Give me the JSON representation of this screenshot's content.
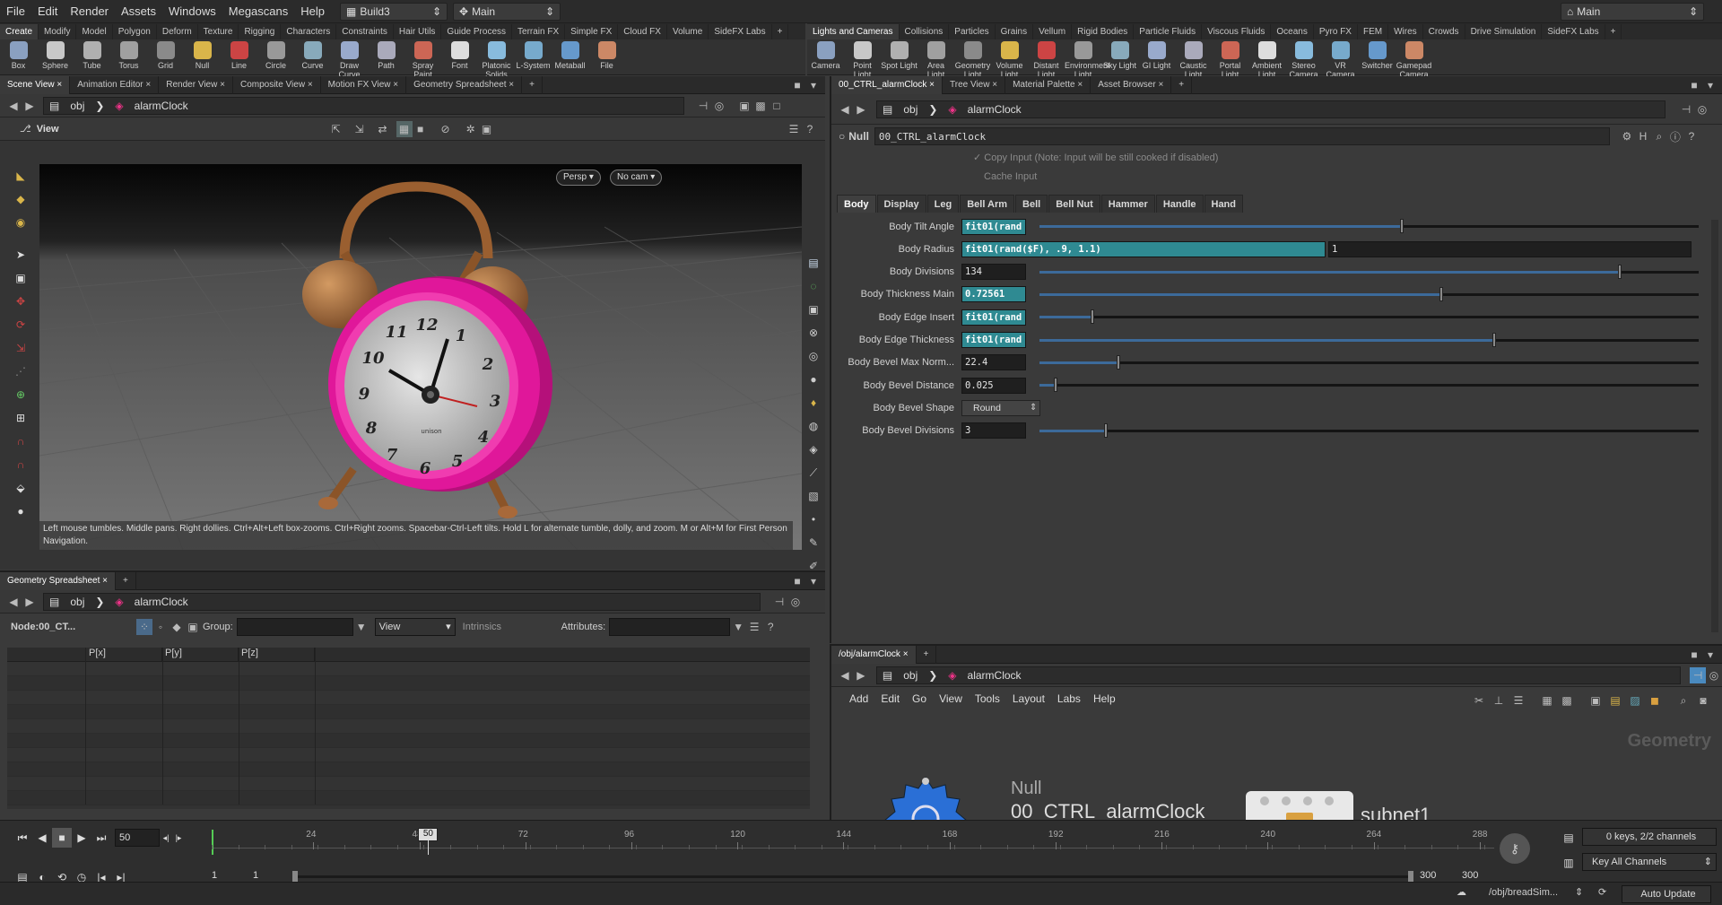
{
  "menu": {
    "items": [
      "File",
      "Edit",
      "Render",
      "Assets",
      "Windows",
      "Megascans",
      "Help"
    ],
    "desktop": "Build3",
    "context": "Main",
    "right_desktop": "Main"
  },
  "shelf_left": {
    "tabs": [
      "Create",
      "Modify",
      "Model",
      "Polygon",
      "Deform",
      "Texture",
      "Rigging",
      "Characters",
      "Constraints",
      "Hair Utils",
      "Guide Process",
      "Terrain FX",
      "Simple FX",
      "Cloud FX",
      "Volume",
      "SideFX Labs"
    ],
    "tools": [
      "Box",
      "Sphere",
      "Tube",
      "Torus",
      "Grid",
      "Null",
      "Line",
      "Circle",
      "Curve",
      "Draw Curve",
      "Path",
      "Spray Paint",
      "Font",
      "Platonic Solids",
      "L-System",
      "Metaball",
      "File"
    ]
  },
  "shelf_right": {
    "tabs": [
      "Lights and Cameras",
      "Collisions",
      "Particles",
      "Grains",
      "Vellum",
      "Rigid Bodies",
      "Particle Fluids",
      "Viscous Fluids",
      "Oceans",
      "Pyro FX",
      "FEM",
      "Wires",
      "Crowds",
      "Drive Simulation",
      "SideFX Labs"
    ],
    "tools": [
      "Camera",
      "Point Light",
      "Spot Light",
      "Area Light",
      "Geometry Light",
      "Volume Light",
      "Distant Light",
      "Environment Light",
      "Sky Light",
      "GI Light",
      "Caustic Light",
      "Portal Light",
      "Ambient Light",
      "Stereo Camera",
      "VR Camera",
      "Switcher",
      "Gamepad Camera"
    ]
  },
  "viewer": {
    "tabs": [
      "Scene View",
      "Animation Editor",
      "Render View",
      "Composite View",
      "Motion FX View",
      "Geometry Spreadsheet"
    ],
    "path_root": "obj",
    "path_node": "alarmClock",
    "title": "View",
    "persp": "Persp",
    "cam": "No cam",
    "hint": "Left mouse tumbles. Middle pans. Right dollies. Ctrl+Alt+Left box-zooms. Ctrl+Right zooms. Spacebar-Ctrl-Left tilts. Hold L for alternate tumble, dolly, and zoom.     M or Alt+M for First Person Navigation.",
    "clock_numbers": [
      "12",
      "1",
      "2",
      "3",
      "4",
      "5",
      "6",
      "7",
      "8",
      "9",
      "10",
      "11"
    ],
    "clock_brand": "unison"
  },
  "spreadsheet": {
    "tab": "Geometry Spreadsheet",
    "path_root": "obj",
    "path_node": "alarmClock",
    "node": "Node:00_CT...",
    "group_label": "Group:",
    "view_label": "View",
    "intrinsics": "Intrinsics",
    "attributes_label": "Attributes:",
    "columns": [
      "",
      "P[x]",
      "P[y]",
      "P[z]"
    ]
  },
  "params": {
    "tabs": [
      "00_CTRL_alarmClock",
      "Tree View",
      "Material Palette",
      "Asset Browser"
    ],
    "path_root": "obj",
    "path_node": "alarmClock",
    "node_type": "Null",
    "node_name": "00_CTRL_alarmClock",
    "copy_input": "Copy Input (Note: Input will be still cooked if disabled)",
    "cache_input": "Cache Input",
    "folder_tabs": [
      "Body",
      "Display",
      "Leg",
      "Bell Arm",
      "Bell",
      "Bell Nut",
      "Hammer",
      "Handle",
      "Hand"
    ],
    "rows": [
      {
        "label": "Body Tilt Angle",
        "value": "fit01(rand",
        "expr": true,
        "slider": 0.55
      },
      {
        "label": "Body Radius",
        "value": "fit01(rand($F), .9, 1.1)",
        "expr": true,
        "second": "1"
      },
      {
        "label": "Body Divisions",
        "value": "134",
        "expr": false,
        "slider": 0.88
      },
      {
        "label": "Body Thickness Main",
        "value": "0.72561",
        "expr": true,
        "slider": 0.61
      },
      {
        "label": "Body Edge Insert",
        "value": "fit01(rand",
        "expr": true,
        "slider": 0.08
      },
      {
        "label": "Body Edge Thickness",
        "value": "fit01(rand",
        "expr": true,
        "slider": 0.69
      },
      {
        "label": "Body Bevel Max Norm...",
        "value": "22.4",
        "expr": false,
        "slider": 0.12
      },
      {
        "label": "Body Bevel Distance",
        "value": "0.025",
        "expr": false,
        "slider": 0.025
      },
      {
        "label": "Body Bevel Shape",
        "value": "Round",
        "menu": true
      },
      {
        "label": "Body Bevel Divisions",
        "value": "3",
        "expr": false,
        "slider": 0.1
      }
    ]
  },
  "network": {
    "tab": "/obj/alarmClock",
    "path_root": "obj",
    "path_node": "alarmClock",
    "menu": [
      "Add",
      "Edit",
      "Go",
      "View",
      "Tools",
      "Layout",
      "Labs",
      "Help"
    ],
    "context_label": "Geometry",
    "node1_type": "Null",
    "node1_name": "00_CTRL_alarmClock",
    "node2_name": "subnet1"
  },
  "timeline": {
    "frame": "50",
    "ticks": [
      "24",
      "48",
      "72",
      "96",
      "120",
      "144",
      "168",
      "192",
      "216",
      "240",
      "264",
      "288"
    ],
    "marker": "50",
    "current": 50,
    "end": 300,
    "start1": "1",
    "start2": "1",
    "end1": "300",
    "end2": "300",
    "keys": "0 keys, 2/2 channels",
    "key_all": "Key All Channels",
    "status_path": "/obj/breadSim...",
    "update": "Auto Update"
  },
  "colors": {
    "expr": "#2f8a92",
    "clock_pink": "#e0179a",
    "bell": "#a8693a"
  }
}
